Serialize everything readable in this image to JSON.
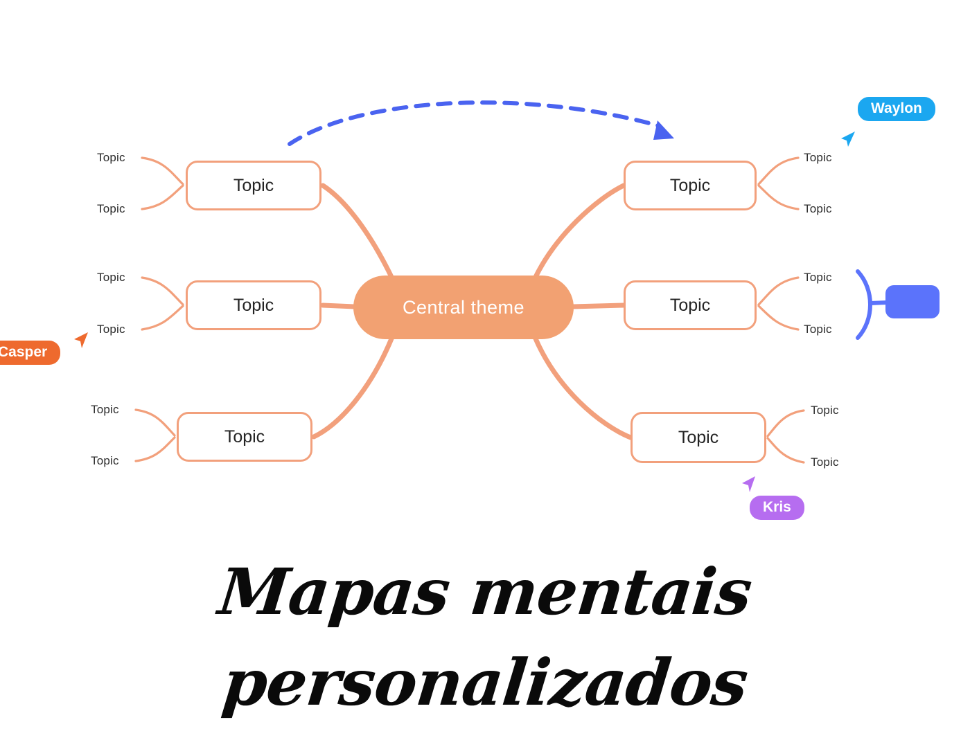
{
  "canvas": {
    "background": "#ffffff",
    "accent_salmon": "#f2a07c",
    "accent_orange": "#f2a172",
    "accent_blue": "#5b73fb",
    "accent_lightblue": "#1ba7f0",
    "accent_purple": "#b66df0",
    "accent_deep_orange": "#ee6a2e"
  },
  "central": {
    "label": "Central  theme"
  },
  "branches": {
    "left": [
      {
        "id": "left-1",
        "label": "Topic",
        "leaves": [
          {
            "label": "Topic"
          },
          {
            "label": "Topic"
          }
        ]
      },
      {
        "id": "left-2",
        "label": "Topic",
        "leaves": [
          {
            "label": "Topic"
          },
          {
            "label": "Topic"
          }
        ]
      },
      {
        "id": "left-3",
        "label": "Topic",
        "leaves": [
          {
            "label": "Topic"
          },
          {
            "label": "Topic"
          }
        ]
      }
    ],
    "right": [
      {
        "id": "right-1",
        "label": "Topic",
        "leaves": [
          {
            "label": "Topic"
          },
          {
            "label": "Topic"
          }
        ]
      },
      {
        "id": "right-2",
        "label": "Topic",
        "leaves": [
          {
            "label": "Topic"
          },
          {
            "label": "Topic"
          }
        ]
      },
      {
        "id": "right-3",
        "label": "Topic",
        "leaves": [
          {
            "label": "Topic"
          },
          {
            "label": "Topic"
          }
        ]
      }
    ]
  },
  "collaborators": [
    {
      "id": "waylon",
      "name": "Waylon",
      "color": "#1ba7f0"
    },
    {
      "id": "casper",
      "name": "Casper",
      "color": "#ee6a2e"
    },
    {
      "id": "kris",
      "name": "Kris",
      "color": "#b66df0"
    }
  ],
  "annotations": {
    "relation_arrow": {
      "name": "dashed-relation-arrow",
      "color": "#4a63f0",
      "style": "dashed"
    },
    "pending_node": {
      "name": "new-node-placeholder",
      "color": "#5b73fb"
    }
  },
  "title": {
    "line1": "Mapas mentais",
    "line2": "personalizados"
  }
}
